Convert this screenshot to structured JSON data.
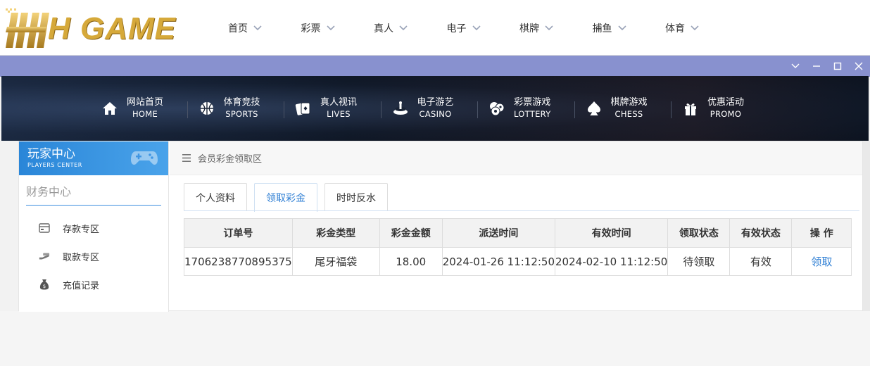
{
  "header": {
    "logo_text": "H GAME",
    "nav": [
      {
        "label": "首页"
      },
      {
        "label": "彩票"
      },
      {
        "label": "真人"
      },
      {
        "label": "电子"
      },
      {
        "label": "棋牌"
      },
      {
        "label": "捕鱼"
      },
      {
        "label": "体育"
      }
    ]
  },
  "window": {
    "controls": [
      "chevron-down-icon",
      "minimize-icon",
      "maximize-icon",
      "close-icon"
    ]
  },
  "game_nav": [
    {
      "cn": "网站首页",
      "en": "HOME",
      "icon": "home-icon"
    },
    {
      "cn": "体育竞技",
      "en": "SPORTS",
      "icon": "basketball-icon"
    },
    {
      "cn": "真人视讯",
      "en": "LIVES",
      "icon": "cards-icon"
    },
    {
      "cn": "电子游艺",
      "en": "CASINO",
      "icon": "slot-icon"
    },
    {
      "cn": "彩票游戏",
      "en": "LOTTERY",
      "icon": "lottery-balls-icon"
    },
    {
      "cn": "棋牌游戏",
      "en": "CHESS",
      "icon": "spade-icon"
    },
    {
      "cn": "优惠活动",
      "en": "PROMO",
      "icon": "gift-icon"
    }
  ],
  "sidebar": {
    "title": "玩家中心",
    "subtitle": "PLAYERS CENTER",
    "section": "财务中心",
    "items": [
      {
        "label": "存款专区",
        "icon": "wallet-icon"
      },
      {
        "label": "取款专区",
        "icon": "cash-icon"
      },
      {
        "label": "充值记录",
        "icon": "money-bag-icon"
      }
    ]
  },
  "main": {
    "breadcrumb": "会员彩金领取区",
    "tabs": [
      {
        "label": "个人资料",
        "active": false
      },
      {
        "label": "领取彩金",
        "active": true
      },
      {
        "label": "时时反水",
        "active": false
      }
    ],
    "table": {
      "headers": [
        "订单号",
        "彩金类型",
        "彩金金额",
        "派送时间",
        "有效时间",
        "领取状态",
        "有效状态",
        "操 作"
      ],
      "rows": [
        [
          "1706238770895375",
          "尾牙福袋",
          "18.00",
          "2024-01-26 11:12:50",
          "2024-02-10 11:12:50",
          "待领取",
          "有效",
          "领取"
        ]
      ]
    }
  },
  "colors": {
    "accent": "#2f7fd4",
    "window_bar": "#8891cf",
    "logo_gold": "#d6a93a"
  }
}
